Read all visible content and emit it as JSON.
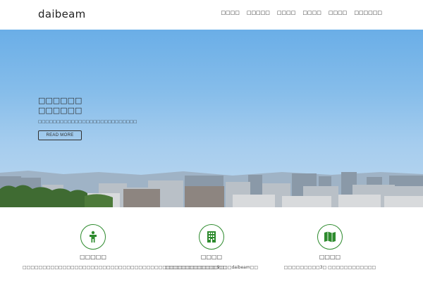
{
  "header": {
    "logo": "daibeam",
    "nav": [
      "□□□□",
      "□□□□□",
      "□□□□",
      "□□□□",
      "□□□□",
      "□□□□□□"
    ]
  },
  "hero": {
    "title_line1": "□□□□□□",
    "title_line2": "□□□□□□",
    "description": "□□□□□□□□□□□□□□□□□□□□□□□□□□□",
    "button_label": "READ MORE"
  },
  "features": [
    {
      "icon": "person-icon",
      "title": "□□□□□",
      "text": "□□□□□□□□□□□□□□□□□□□□□□□□□□□□□□□□□□□□□□□□□□□□□□□□□□□"
    },
    {
      "icon": "building-icon",
      "title": "□□□□",
      "text": "□□□□□□□□□□□□□9□□□daibeam□□"
    },
    {
      "icon": "map-icon",
      "title": "□□□□",
      "text": "□□□□□□□□□3□ □□□□□□□□□□□□"
    }
  ],
  "colors": {
    "accent_green": "#2e8b2e",
    "sky_top": "#6aaee7",
    "sky_bottom": "#bcd7ef"
  }
}
